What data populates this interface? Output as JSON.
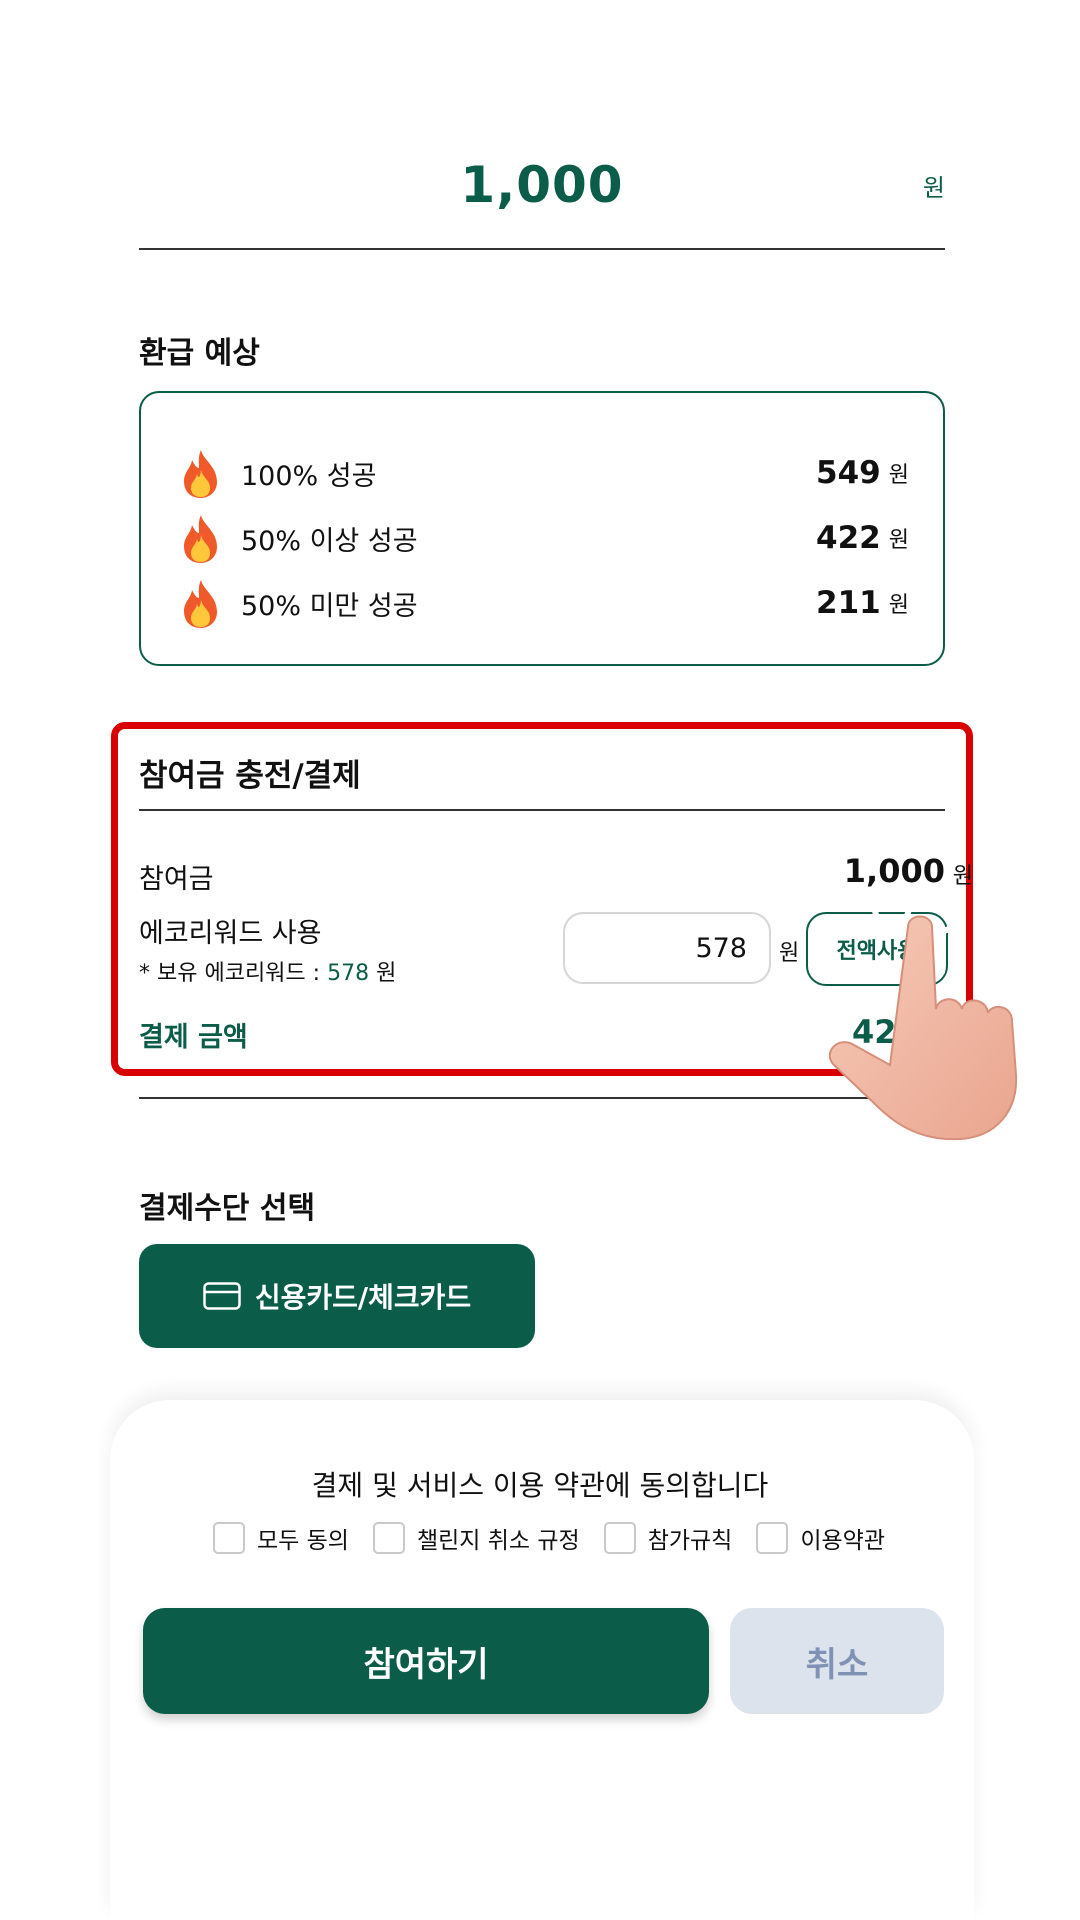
{
  "top": {
    "amount": "1,000",
    "unit": "원"
  },
  "refund": {
    "title": "환급 예상",
    "rows": [
      {
        "label": "100% 성공",
        "value": "549",
        "unit": "원"
      },
      {
        "label": "50% 이상 성공",
        "value": "422",
        "unit": "원"
      },
      {
        "label": "50% 미만 성공",
        "value": "211",
        "unit": "원"
      }
    ]
  },
  "payment": {
    "title": "참여금 충전/결제",
    "participation_label": "참여금",
    "participation_amount": "1,000",
    "participation_unit": "원",
    "eco_label": "에코리워드 사용",
    "eco_note_prefix": "* 보유 에코리워드 : ",
    "eco_note_value": "578",
    "eco_note_unit": " 원",
    "eco_input_value": "578",
    "eco_input_unit": "원",
    "all_use_button": "전액사용",
    "total_label": "결제 금액",
    "total_value": "422"
  },
  "method": {
    "title": "결제수단 선택",
    "card_button": "신용카드/체크카드"
  },
  "agreement": {
    "title": "결제 및 서비스 이용 약관에 동의합니다",
    "checks": [
      "모두 동의",
      "챌린지 취소 규정",
      "참가규칙",
      "이용약관"
    ]
  },
  "actions": {
    "join": "참여하기",
    "cancel": "취소"
  },
  "colors": {
    "brand": "#0b5c49",
    "highlight": "#d90000",
    "cancel_bg": "#dde3ec"
  }
}
